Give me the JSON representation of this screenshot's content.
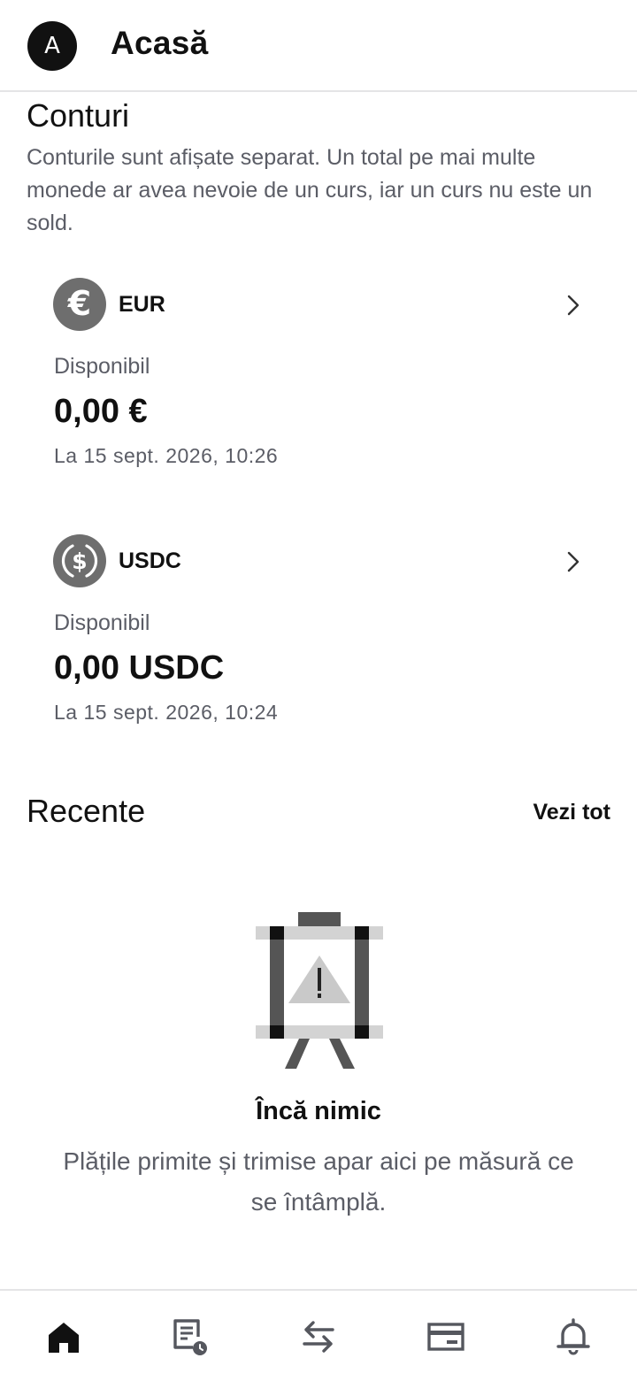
{
  "header": {
    "avatar_initial": "A",
    "title": "Acasă"
  },
  "accounts": {
    "title": "Conturi",
    "description": "Conturile sunt afișate separat. Un total pe mai multe monede ar avea nevoie de un curs, iar un curs nu este un sold.",
    "items": [
      {
        "currency": "EUR",
        "icon": "euro-icon",
        "available_label": "Disponibil",
        "balance": "0,00 €",
        "timestamp": "La 15 sept. 2026, 10:26"
      },
      {
        "currency": "USDC",
        "icon": "usdc-dollar-icon",
        "available_label": "Disponibil",
        "balance": "0,00 USDC",
        "timestamp": "La 15 sept. 2026, 10:24"
      }
    ]
  },
  "recent": {
    "title": "Recente",
    "see_all_label": "Vezi tot",
    "empty_title": "Încă nimic",
    "empty_description": "Plățile primite și trimise apar aici pe măsură ce se întâmplă."
  },
  "bottom_nav": {
    "items": [
      {
        "icon": "home-icon",
        "active": true
      },
      {
        "icon": "activity-icon",
        "active": false
      },
      {
        "icon": "transfer-icon",
        "active": false
      },
      {
        "icon": "card-icon",
        "active": false
      },
      {
        "icon": "bell-icon",
        "active": false
      }
    ]
  },
  "colors": {
    "primary_text": "#111111",
    "secondary_text": "#5b5d66",
    "icon_grey": "#6e6e6e",
    "divider": "#e4e4e6",
    "nav_inactive": "#55575e"
  }
}
